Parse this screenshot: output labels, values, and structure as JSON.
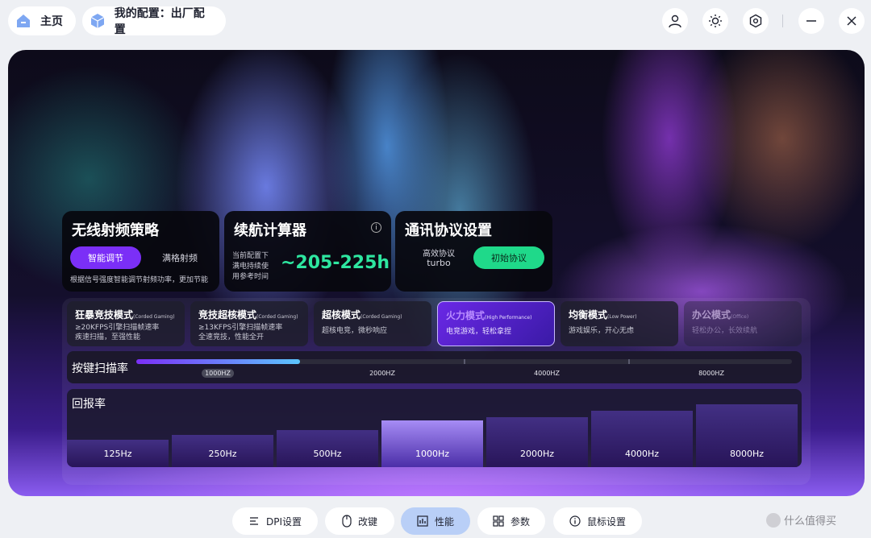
{
  "header": {
    "home_label": "主页",
    "config_label": "我的配置：出厂配置"
  },
  "cards": {
    "rf": {
      "title": "无线射频策略",
      "btn_smart": "智能调节",
      "btn_full": "满格射频",
      "desc": "根据信号强度智能调节射频功率，更加节能"
    },
    "battery": {
      "title": "续航计算器",
      "note_line1": "当前配置下",
      "note_line2": "满电持续使",
      "note_line3": "用参考时间",
      "value": "~205-225h"
    },
    "protocol": {
      "title": "通讯协议设置",
      "label": "高效协议",
      "value": "turbo",
      "btn": "初始协议"
    }
  },
  "modes": [
    {
      "name": "狂暴竞技模式",
      "sub": "(Corded Gaming)",
      "desc1": "≥20KFPS引擎扫描帧速率",
      "desc2": "疾速扫描，至强性能"
    },
    {
      "name": "竞技超核模式",
      "sub": "(Corded Gaming)",
      "desc1": "≥13KFPS引擎扫描帧速率",
      "desc2": "全速竞技，性能全开"
    },
    {
      "name": "超核模式",
      "sub": "(Corded Gaming)",
      "desc1": "超核电竞，微秒响应",
      "desc2": ""
    },
    {
      "name": "火力模式",
      "sub": "(High Performance)",
      "desc1": "电竞游戏，轻松拿捏",
      "desc2": ""
    },
    {
      "name": "均衡模式",
      "sub": "(Low Power)",
      "desc1": "游戏娱乐，开心无虑",
      "desc2": ""
    },
    {
      "name": "办公模式",
      "sub": "(Office)",
      "desc1": "轻松办公，长效续航",
      "desc2": ""
    }
  ],
  "scan": {
    "title": "按键扫描率",
    "labels": [
      "1000HZ",
      "2000HZ",
      "4000HZ",
      "8000HZ"
    ],
    "selected": "1000HZ",
    "progress": 0.25
  },
  "report": {
    "title": "回报率",
    "rates": [
      "125Hz",
      "250Hz",
      "500Hz",
      "1000Hz",
      "2000Hz",
      "4000Hz",
      "8000Hz"
    ],
    "selected": "1000Hz"
  },
  "tabs": [
    {
      "label": "DPI设置",
      "icon": "dpi-icon"
    },
    {
      "label": "改键",
      "icon": "mouse-icon"
    },
    {
      "label": "性能",
      "icon": "chart-icon"
    },
    {
      "label": "参数",
      "icon": "grid-icon"
    },
    {
      "label": "鼠标设置",
      "icon": "info-icon"
    }
  ],
  "active_tab": "性能",
  "watermark": "什么值得买",
  "colors": {
    "accent_purple": "#7b2ff7",
    "accent_green": "#1fd98a",
    "value_green": "#2ee6a0",
    "active_tab": "#b9cff7"
  }
}
